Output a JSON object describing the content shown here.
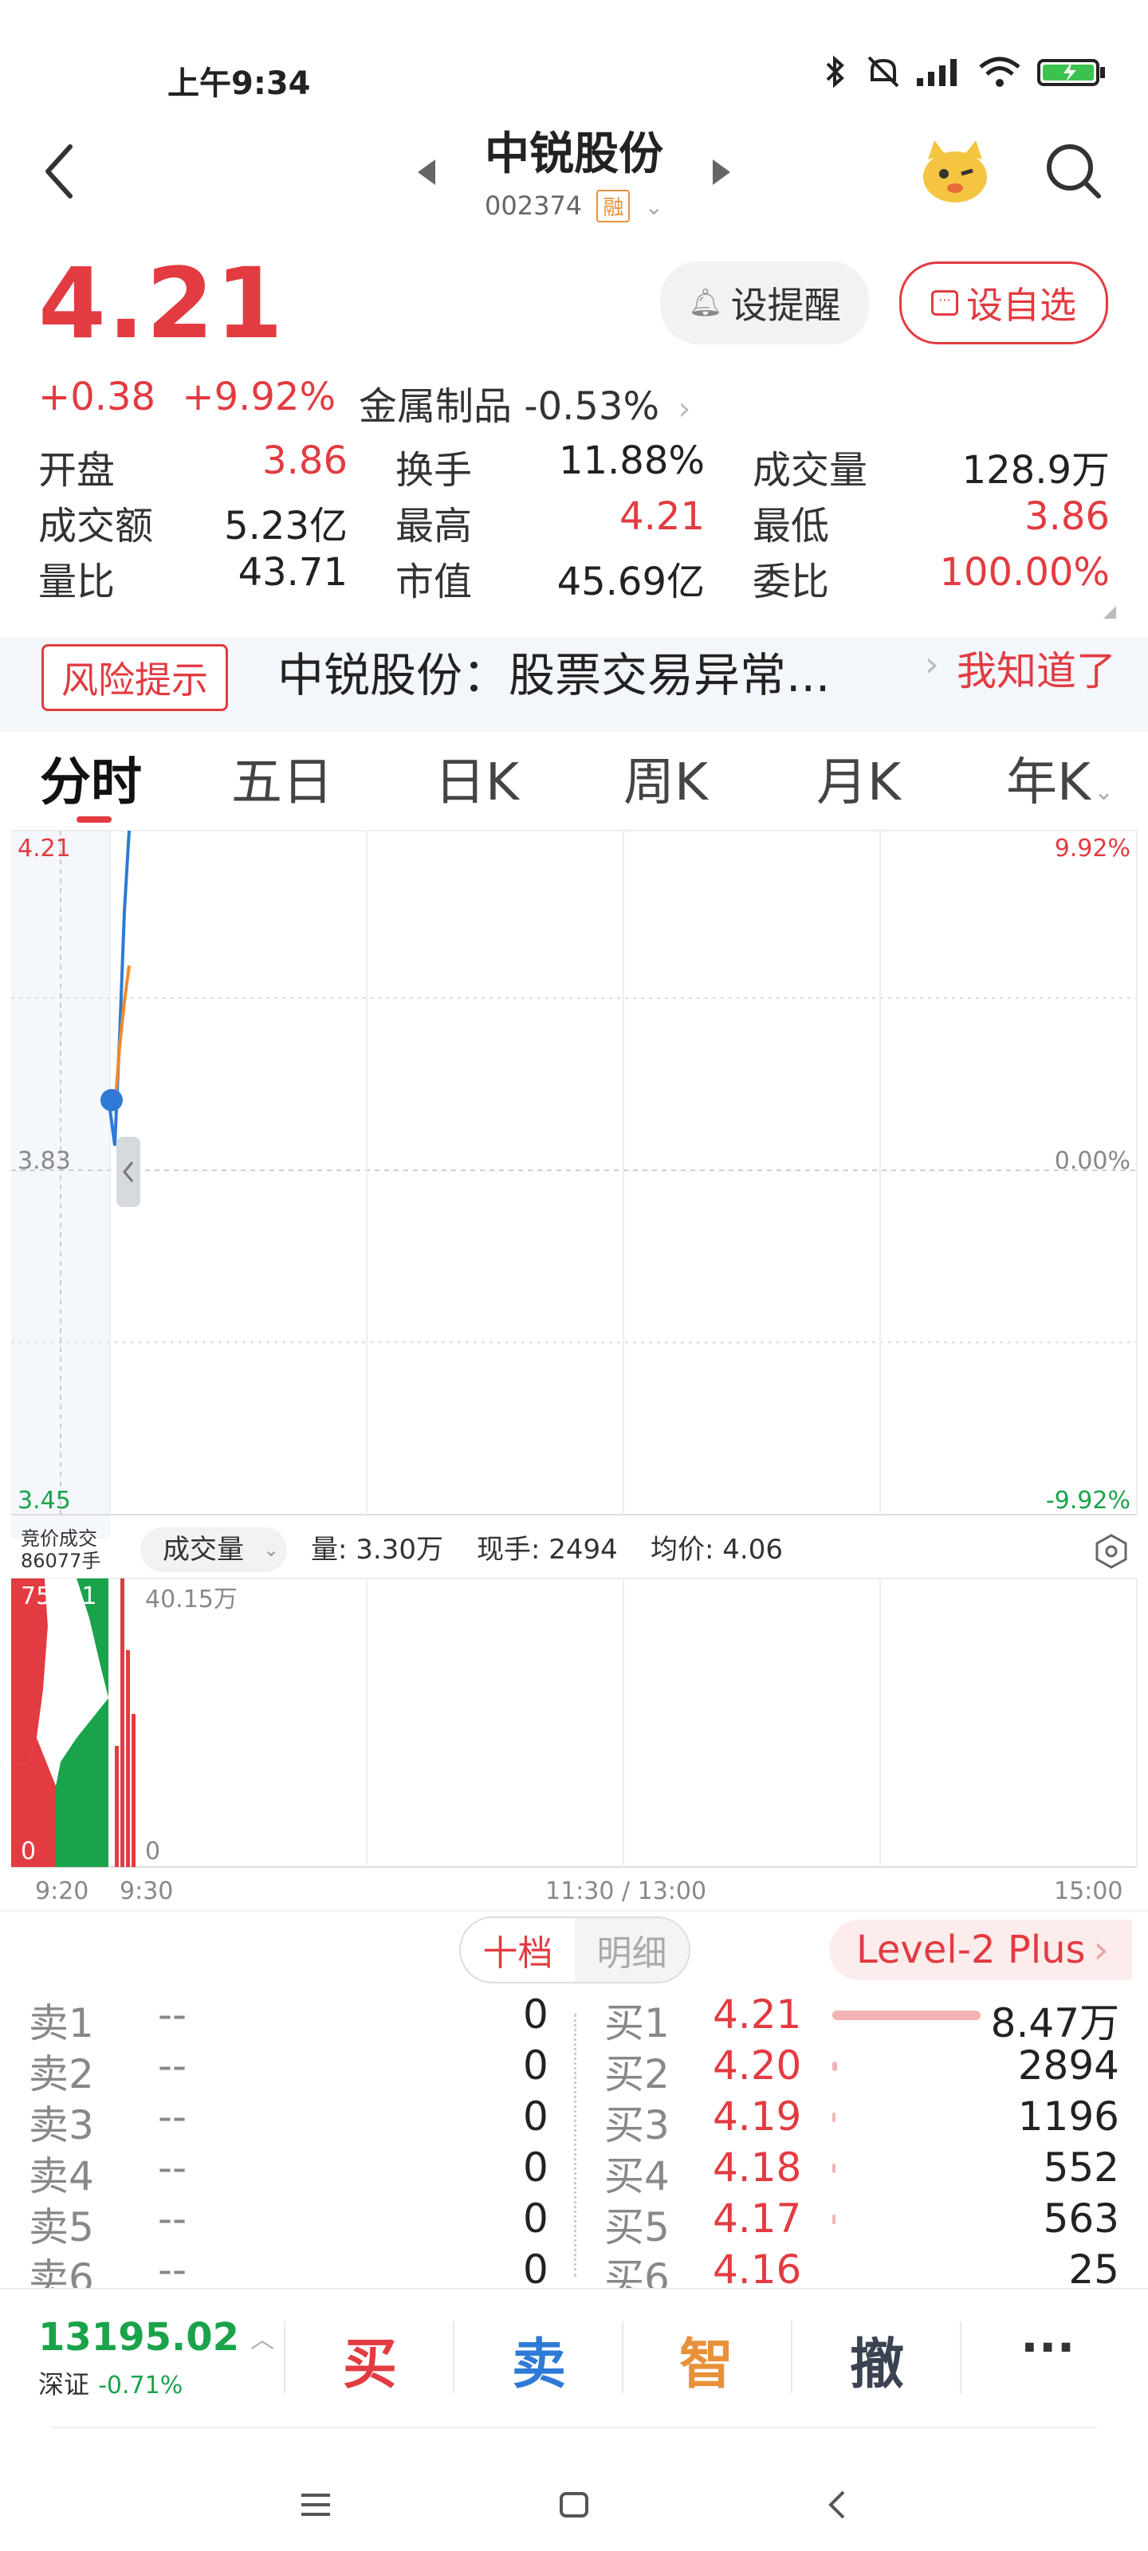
{
  "status_bar": {
    "time": "上午9:34",
    "icons": [
      "bluetooth-icon",
      "mute-icon",
      "hd-signal-icon",
      "wifi-icon",
      "battery-charging-icon"
    ]
  },
  "header": {
    "title": "中锐股份",
    "code": "002374",
    "margin_badge": "融",
    "mascot_icon": "mascot-icon",
    "search_icon": "search-icon"
  },
  "quote": {
    "price": "4.21",
    "change": "+0.38",
    "change_pct": "+9.92%",
    "sector": "金属制品 -0.53%",
    "remind_label": "设提醒",
    "watch_label": "设自选",
    "stats": [
      [
        {
          "k": "开盘",
          "v": "3.86",
          "c": "red"
        },
        {
          "k": "换手",
          "v": "11.88%",
          "c": "dark"
        },
        {
          "k": "成交量",
          "v": "128.9万",
          "c": "dark"
        }
      ],
      [
        {
          "k": "成交额",
          "v": "5.23亿",
          "c": "dark"
        },
        {
          "k": "最高",
          "v": "4.21",
          "c": "red"
        },
        {
          "k": "最低",
          "v": "3.86",
          "c": "red"
        }
      ],
      [
        {
          "k": "量比",
          "v": "43.71",
          "c": "dark"
        },
        {
          "k": "市值",
          "v": "45.69亿",
          "c": "dark"
        },
        {
          "k": "委比",
          "v": "100.00%",
          "c": "red"
        }
      ]
    ]
  },
  "risk": {
    "tag": "风险提示",
    "text": "中锐股份：股票交易异常...",
    "ok": "我知道了"
  },
  "tabs": [
    "分时",
    "五日",
    "日K",
    "周K",
    "月K",
    "年K"
  ],
  "chart": {
    "price_high": "4.21",
    "price_mid": "3.83",
    "price_low": "3.45",
    "pct_high": "9.92%",
    "pct_mid": "0.00%",
    "pct_low": "-9.92%",
    "auction_label": "竞价成交",
    "auction_volume": "86077手",
    "volume_selector": "成交量",
    "vol_info": "量: 3.30万",
    "now_hand": "现手: 2494",
    "avg_price": "均价: 4.06",
    "vol_max": "40.15万",
    "vol_zero": "0",
    "auction_max": "75871",
    "auction_zero": "0",
    "time_labels": [
      "9:20",
      "9:30",
      "11:30 / 13:00",
      "15:00"
    ]
  },
  "chart_data": {
    "type": "line",
    "series": [
      {
        "name": "price",
        "x": [
          "9:30",
          "9:31",
          "9:32",
          "9:33",
          "9:34"
        ],
        "values": [
          3.9,
          3.86,
          3.98,
          4.12,
          4.21
        ]
      },
      {
        "name": "avg",
        "x": [
          "9:30",
          "9:31",
          "9:32",
          "9:33",
          "9:34"
        ],
        "values": [
          3.92,
          3.9,
          3.97,
          4.02,
          4.06
        ]
      }
    ],
    "ylim": [
      3.45,
      4.21
    ],
    "x_labels": [
      "9:20",
      "9:30",
      "11:30 / 13:00",
      "15:00"
    ]
  },
  "orderbook": {
    "tab_active": "十档",
    "tab_inactive": "明细",
    "level2": "Level-2 Plus",
    "asks": [
      {
        "label": "卖1",
        "price": "--",
        "vol": "0"
      },
      {
        "label": "卖2",
        "price": "--",
        "vol": "0"
      },
      {
        "label": "卖3",
        "price": "--",
        "vol": "0"
      },
      {
        "label": "卖4",
        "price": "--",
        "vol": "0"
      },
      {
        "label": "卖5",
        "price": "--",
        "vol": "0"
      },
      {
        "label": "卖6",
        "price": "--",
        "vol": "0"
      }
    ],
    "bids": [
      {
        "label": "买1",
        "price": "4.21",
        "vol": "8.47万",
        "bar": 1.0
      },
      {
        "label": "买2",
        "price": "4.20",
        "vol": "2894",
        "bar": 0.03
      },
      {
        "label": "买3",
        "price": "4.19",
        "vol": "1196",
        "bar": 0.015
      },
      {
        "label": "买4",
        "price": "4.18",
        "vol": "552",
        "bar": 0.008
      },
      {
        "label": "买5",
        "price": "4.17",
        "vol": "563",
        "bar": 0.008
      },
      {
        "label": "买6",
        "price": "4.16",
        "vol": "25",
        "bar": 0.0
      }
    ]
  },
  "bottom": {
    "index_value": "13195.02",
    "index_name": "深证",
    "index_change": "-0.71%",
    "buy": "买",
    "sell": "卖",
    "smart": "智",
    "cancel": "撤",
    "more": "···"
  }
}
